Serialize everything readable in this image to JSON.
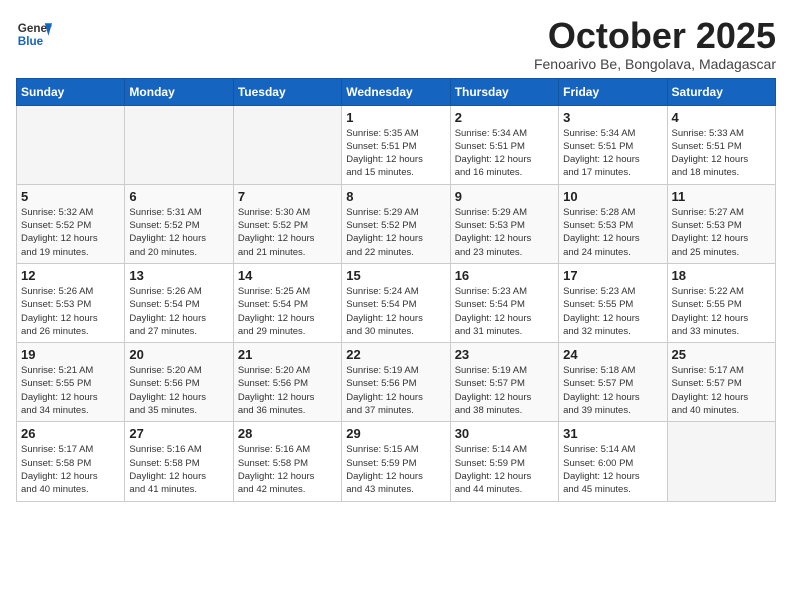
{
  "header": {
    "logo_line1": "General",
    "logo_line2": "Blue",
    "month": "October 2025",
    "location": "Fenoarivo Be, Bongolava, Madagascar"
  },
  "weekdays": [
    "Sunday",
    "Monday",
    "Tuesday",
    "Wednesday",
    "Thursday",
    "Friday",
    "Saturday"
  ],
  "weeks": [
    [
      {
        "day": "",
        "info": ""
      },
      {
        "day": "",
        "info": ""
      },
      {
        "day": "",
        "info": ""
      },
      {
        "day": "1",
        "info": "Sunrise: 5:35 AM\nSunset: 5:51 PM\nDaylight: 12 hours\nand 15 minutes."
      },
      {
        "day": "2",
        "info": "Sunrise: 5:34 AM\nSunset: 5:51 PM\nDaylight: 12 hours\nand 16 minutes."
      },
      {
        "day": "3",
        "info": "Sunrise: 5:34 AM\nSunset: 5:51 PM\nDaylight: 12 hours\nand 17 minutes."
      },
      {
        "day": "4",
        "info": "Sunrise: 5:33 AM\nSunset: 5:51 PM\nDaylight: 12 hours\nand 18 minutes."
      }
    ],
    [
      {
        "day": "5",
        "info": "Sunrise: 5:32 AM\nSunset: 5:52 PM\nDaylight: 12 hours\nand 19 minutes."
      },
      {
        "day": "6",
        "info": "Sunrise: 5:31 AM\nSunset: 5:52 PM\nDaylight: 12 hours\nand 20 minutes."
      },
      {
        "day": "7",
        "info": "Sunrise: 5:30 AM\nSunset: 5:52 PM\nDaylight: 12 hours\nand 21 minutes."
      },
      {
        "day": "8",
        "info": "Sunrise: 5:29 AM\nSunset: 5:52 PM\nDaylight: 12 hours\nand 22 minutes."
      },
      {
        "day": "9",
        "info": "Sunrise: 5:29 AM\nSunset: 5:53 PM\nDaylight: 12 hours\nand 23 minutes."
      },
      {
        "day": "10",
        "info": "Sunrise: 5:28 AM\nSunset: 5:53 PM\nDaylight: 12 hours\nand 24 minutes."
      },
      {
        "day": "11",
        "info": "Sunrise: 5:27 AM\nSunset: 5:53 PM\nDaylight: 12 hours\nand 25 minutes."
      }
    ],
    [
      {
        "day": "12",
        "info": "Sunrise: 5:26 AM\nSunset: 5:53 PM\nDaylight: 12 hours\nand 26 minutes."
      },
      {
        "day": "13",
        "info": "Sunrise: 5:26 AM\nSunset: 5:54 PM\nDaylight: 12 hours\nand 27 minutes."
      },
      {
        "day": "14",
        "info": "Sunrise: 5:25 AM\nSunset: 5:54 PM\nDaylight: 12 hours\nand 29 minutes."
      },
      {
        "day": "15",
        "info": "Sunrise: 5:24 AM\nSunset: 5:54 PM\nDaylight: 12 hours\nand 30 minutes."
      },
      {
        "day": "16",
        "info": "Sunrise: 5:23 AM\nSunset: 5:54 PM\nDaylight: 12 hours\nand 31 minutes."
      },
      {
        "day": "17",
        "info": "Sunrise: 5:23 AM\nSunset: 5:55 PM\nDaylight: 12 hours\nand 32 minutes."
      },
      {
        "day": "18",
        "info": "Sunrise: 5:22 AM\nSunset: 5:55 PM\nDaylight: 12 hours\nand 33 minutes."
      }
    ],
    [
      {
        "day": "19",
        "info": "Sunrise: 5:21 AM\nSunset: 5:55 PM\nDaylight: 12 hours\nand 34 minutes."
      },
      {
        "day": "20",
        "info": "Sunrise: 5:20 AM\nSunset: 5:56 PM\nDaylight: 12 hours\nand 35 minutes."
      },
      {
        "day": "21",
        "info": "Sunrise: 5:20 AM\nSunset: 5:56 PM\nDaylight: 12 hours\nand 36 minutes."
      },
      {
        "day": "22",
        "info": "Sunrise: 5:19 AM\nSunset: 5:56 PM\nDaylight: 12 hours\nand 37 minutes."
      },
      {
        "day": "23",
        "info": "Sunrise: 5:19 AM\nSunset: 5:57 PM\nDaylight: 12 hours\nand 38 minutes."
      },
      {
        "day": "24",
        "info": "Sunrise: 5:18 AM\nSunset: 5:57 PM\nDaylight: 12 hours\nand 39 minutes."
      },
      {
        "day": "25",
        "info": "Sunrise: 5:17 AM\nSunset: 5:57 PM\nDaylight: 12 hours\nand 40 minutes."
      }
    ],
    [
      {
        "day": "26",
        "info": "Sunrise: 5:17 AM\nSunset: 5:58 PM\nDaylight: 12 hours\nand 40 minutes."
      },
      {
        "day": "27",
        "info": "Sunrise: 5:16 AM\nSunset: 5:58 PM\nDaylight: 12 hours\nand 41 minutes."
      },
      {
        "day": "28",
        "info": "Sunrise: 5:16 AM\nSunset: 5:58 PM\nDaylight: 12 hours\nand 42 minutes."
      },
      {
        "day": "29",
        "info": "Sunrise: 5:15 AM\nSunset: 5:59 PM\nDaylight: 12 hours\nand 43 minutes."
      },
      {
        "day": "30",
        "info": "Sunrise: 5:14 AM\nSunset: 5:59 PM\nDaylight: 12 hours\nand 44 minutes."
      },
      {
        "day": "31",
        "info": "Sunrise: 5:14 AM\nSunset: 6:00 PM\nDaylight: 12 hours\nand 45 minutes."
      },
      {
        "day": "",
        "info": ""
      }
    ]
  ]
}
